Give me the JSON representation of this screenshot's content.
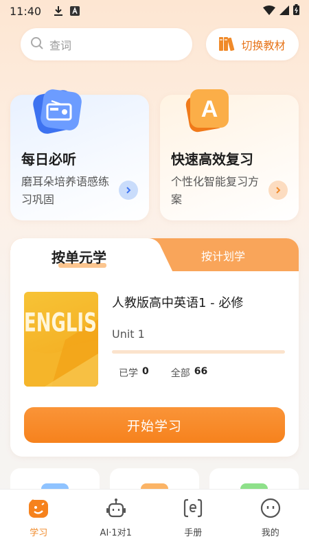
{
  "status_bar": {
    "time": "11:40"
  },
  "search": {
    "placeholder": "查词"
  },
  "switch": {
    "label": "切换教材"
  },
  "cards": [
    {
      "title": "每日必听",
      "desc": "磨耳朵培养语感练习巩固",
      "icon": "radio-icon"
    },
    {
      "title": "快速高效复习",
      "desc": "个性化智能复习方案",
      "icon": "letter-a-icon",
      "icon_letter": "A"
    }
  ],
  "unit_panel": {
    "tabs": [
      "按单元学",
      "按计划学"
    ],
    "active_tab": 0,
    "book": {
      "cover_text": "ENGLISH",
      "name": "人教版高中英语1 - 必修",
      "unit": "Unit 1",
      "learned_label": "已学",
      "learned": "0",
      "total_label": "全部",
      "total": "66",
      "progress": 0
    },
    "start_label": "开始学习"
  },
  "tabbar": [
    {
      "label": "学习",
      "icon": "study-icon",
      "active": true
    },
    {
      "label": "AI·1对1",
      "icon": "robot-icon",
      "active": false
    },
    {
      "label": "手册",
      "icon": "handbook-icon",
      "active": false
    },
    {
      "label": "我的",
      "icon": "profile-icon",
      "active": false
    }
  ],
  "colors": {
    "accent": "#f6821d",
    "tab_bg": "#f9a55a",
    "active_tab_text": "#f08a2a"
  }
}
